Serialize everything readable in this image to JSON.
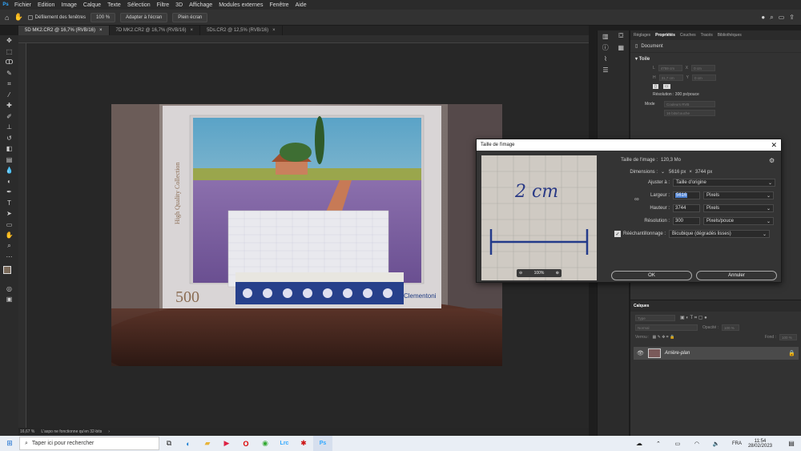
{
  "menu": {
    "app_icon": "Ps",
    "items": [
      "Fichier",
      "Edition",
      "Image",
      "Calque",
      "Texte",
      "Sélection",
      "Filtre",
      "3D",
      "Affichage",
      "Modules externes",
      "Fenêtre",
      "Aide"
    ]
  },
  "options": {
    "scroll_all_label": "Défilement des fenêtres",
    "zoom_100": "100 %",
    "fit_screen": "Adapter à l'écran",
    "full_screen": "Plein écran"
  },
  "tabs": [
    {
      "label": "5D MK2.CR2 @ 16,7% (RVB/16)",
      "active": true
    },
    {
      "label": "7D MK2.CR2 @ 16,7% (RVB/16)",
      "active": false
    },
    {
      "label": "5Ds.CR2 @ 12,5% (RVB/16)",
      "active": false
    }
  ],
  "status": {
    "zoom": "16,67 %",
    "message": "L'aspo ne fonctionne qu'en 32-bits"
  },
  "properties": {
    "tabs": [
      "Réglages",
      "Propriétés",
      "Couches",
      "Tracés",
      "Bibliothèques"
    ],
    "active_tab": "Propriétés",
    "doc_label": "Document",
    "section": "Toile",
    "w": "4759 cm",
    "h": "31,7 cm",
    "x": "0 cm",
    "y": "0 cm",
    "resolution": "Résolution : 300 px/pouce",
    "mode_label": "Mode",
    "mode_value": "Couleurs RVB",
    "bits_value": "16 bits/couche"
  },
  "layers": {
    "title": "Calques",
    "kind": "Type",
    "blend": "Normal",
    "opacity_label": "Opacité :",
    "opacity": "100 %",
    "lock_label": "Verrou :",
    "fill_label": "Fond :",
    "fill": "100 %",
    "layer_name": "Arrière-plan"
  },
  "dialog": {
    "title": "Taille de l'image",
    "preview_zoom": "100%",
    "size_label": "Taille de l'image :",
    "size_value": "120,3 Mo",
    "dim_label": "Dimensions :",
    "dim_w": "5616 px",
    "dim_x": "×",
    "dim_h": "3744 px",
    "fit_label": "Ajuster à :",
    "fit_value": "Taille d'origine",
    "width_label": "Largeur :",
    "width_value": "5616",
    "width_unit": "Pixels",
    "height_label": "Hauteur :",
    "height_value": "3744",
    "height_unit": "Pixels",
    "res_label": "Résolution :",
    "res_value": "300",
    "res_unit": "Pixels/pouce",
    "resample_label": "Rééchantillonnage :",
    "resample_value": "Bicubique (dégradés lisses)",
    "ok": "OK",
    "cancel": "Annuler",
    "preview_text": "2 cm"
  },
  "photo": {
    "puzzle_count": "500",
    "brand": "Clementoni",
    "series": "High Quality Collection"
  },
  "taskbar": {
    "search_placeholder": "Taper ici pour rechercher",
    "lang": "FRA",
    "time": "11:54",
    "date": "28/02/2023"
  },
  "colors": {
    "accent": "#31a8ff",
    "panel": "#323232",
    "dark": "#1e1e1e"
  }
}
